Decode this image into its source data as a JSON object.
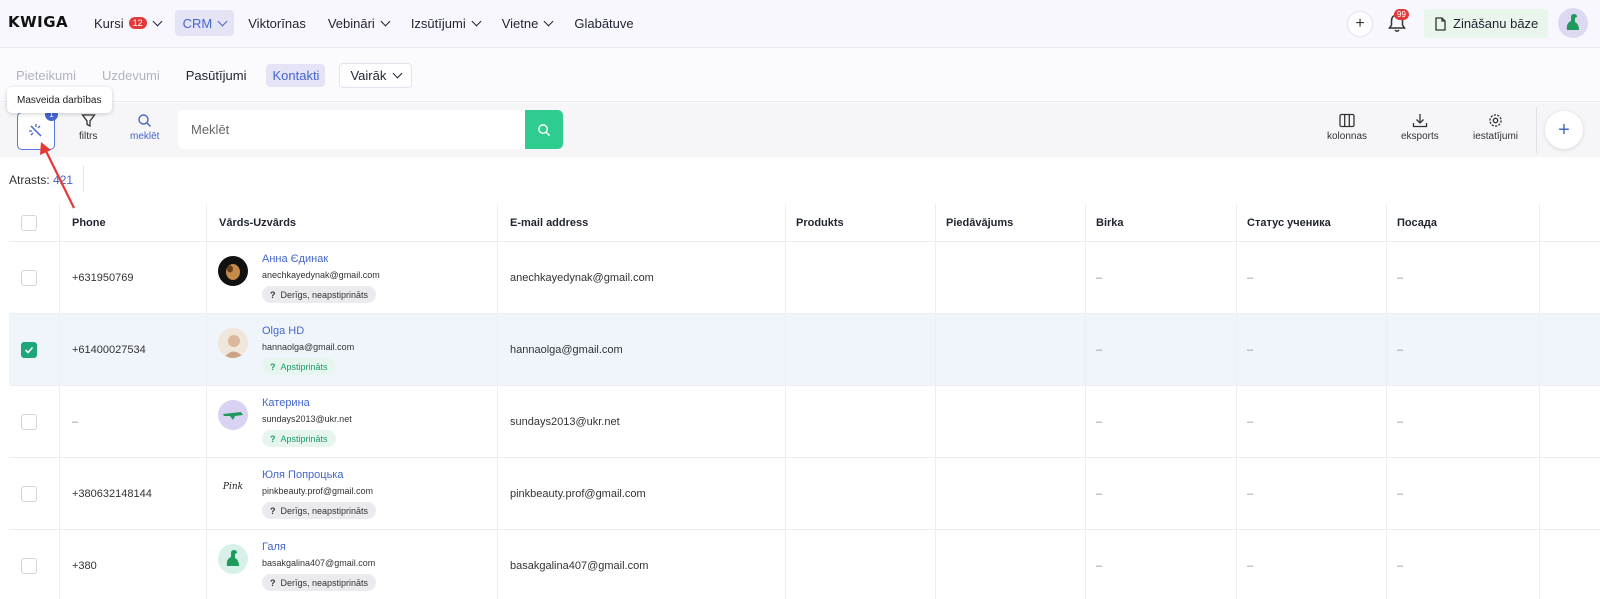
{
  "topbar": {
    "logo": "KWIGA",
    "nav": [
      {
        "label": "Kursi",
        "badge": "12",
        "chevron": true,
        "active": false
      },
      {
        "label": "CRM",
        "chevron": true,
        "active": true
      },
      {
        "label": "Viktorīnas",
        "chevron": false,
        "active": false
      },
      {
        "label": "Vebināri",
        "chevron": true,
        "active": false
      },
      {
        "label": "Izsūtījumi",
        "chevron": true,
        "active": false
      },
      {
        "label": "Vietne",
        "chevron": true,
        "active": false
      },
      {
        "label": "Glabātuve",
        "chevron": false,
        "active": false
      }
    ],
    "notifications_badge": "99",
    "knowledge_base_label": "Zināšanu bāze"
  },
  "subnav": {
    "items": [
      {
        "label": "Pieteikumi",
        "state": "dim"
      },
      {
        "label": "Uzdevumi",
        "state": "dim"
      },
      {
        "label": "Pasūtījumi",
        "state": "normal"
      },
      {
        "label": "Kontakti",
        "state": "active"
      }
    ],
    "more_label": "Vairāk"
  },
  "tooltip": "Masveida darbības",
  "toolbar": {
    "mass_badge": "1",
    "filter_label": "filtrs",
    "search_label": "meklēt",
    "search_placeholder": "Meklēt",
    "columns_label": "kolonnas",
    "export_label": "eksports",
    "settings_label": "iestatījumi"
  },
  "found": {
    "label": "Atrasts:",
    "count": "421"
  },
  "colors": {
    "accent": "#4466cc",
    "search_button": "#2ecc8f",
    "checked": "#1fa67a"
  },
  "table": {
    "headers": [
      "Phone",
      "Vārds-Uzvārds",
      "E-mail address",
      "Produkts",
      "Piedāvājums",
      "Birka",
      "Статус ученика",
      "Посада"
    ],
    "rows": [
      {
        "phone": "+631950769",
        "name": "Анна Єдинак",
        "email": "anechkayedynak@gmail.com",
        "status": "Derīgs, neapstiprināts",
        "status_kind": "grey",
        "tag": "–",
        "student_status": "–",
        "position": "–",
        "checked": false,
        "avatar": "dark-photo"
      },
      {
        "phone": "+61400027534",
        "name": "Olga HD",
        "email": "hannaolga@gmail.com",
        "status": "Apstiprināts",
        "status_kind": "green",
        "tag": "–",
        "student_status": "–",
        "position": "–",
        "checked": true,
        "avatar": "light-photo"
      },
      {
        "phone": "–",
        "name": "Катерина",
        "email": "sundays2013@ukr.net",
        "status": "Apstiprināts",
        "status_kind": "green",
        "tag": "–",
        "student_status": "–",
        "position": "–",
        "checked": false,
        "avatar": "crocodile"
      },
      {
        "phone": "+380632148144",
        "name": "Юля Попроцька",
        "email": "pinkbeauty.prof@gmail.com",
        "status": "Derīgs, neapstiprināts",
        "status_kind": "grey",
        "tag": "–",
        "student_status": "–",
        "position": "–",
        "checked": false,
        "avatar": "pink-logo",
        "avatar_text": "Pink"
      },
      {
        "phone": "+380",
        "name": "Галя",
        "email": "basakgalina407@gmail.com",
        "status": "Derīgs, neapstiprināts",
        "status_kind": "grey",
        "tag": "–",
        "student_status": "–",
        "position": "–",
        "checked": false,
        "avatar": "dinosaur"
      }
    ]
  }
}
